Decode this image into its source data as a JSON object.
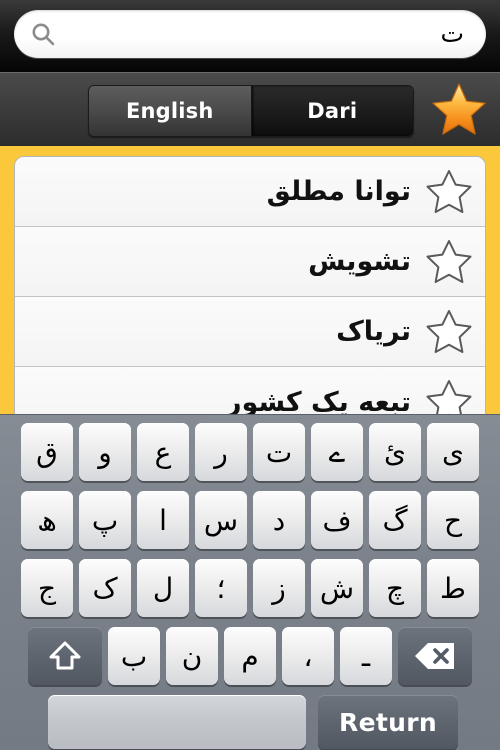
{
  "search": {
    "icon": "search-icon",
    "value": "ت",
    "placeholder": ""
  },
  "toolbar": {
    "segments": [
      {
        "label": "English",
        "selected": false
      },
      {
        "label": "Dari",
        "selected": true
      }
    ],
    "favorites_icon": "star-filled-icon",
    "accent_color": "#f79620"
  },
  "list": {
    "background_color": "#fbc83c",
    "rows": [
      {
        "star_icon": "star-outline-icon",
        "word": "توانا مطلق"
      },
      {
        "star_icon": "star-outline-icon",
        "word": "تشویش"
      },
      {
        "star_icon": "star-outline-icon",
        "word": "تریاک"
      },
      {
        "star_icon": "star-outline-icon",
        "word": "تبعه یک کشور"
      }
    ]
  },
  "keyboard": {
    "rows": [
      [
        "ق",
        "و",
        "ع",
        "ر",
        "ت",
        "ے",
        "ئ",
        "ی"
      ],
      [
        "ھ",
        "پ",
        "ا",
        "س",
        "د",
        "ف",
        "گ",
        "ح"
      ],
      [
        "ج",
        "ک",
        "ل",
        "؛",
        "ز",
        "ش",
        "چ",
        "ط"
      ]
    ],
    "row4": {
      "shift_icon": "shift-up-arrow-icon",
      "keys": [
        "ب",
        "ن",
        "م",
        "،",
        "ـ"
      ],
      "backspace_icon": "backspace-delete-icon"
    },
    "bottom": {
      "space_label": "",
      "return_label": "Return"
    }
  }
}
